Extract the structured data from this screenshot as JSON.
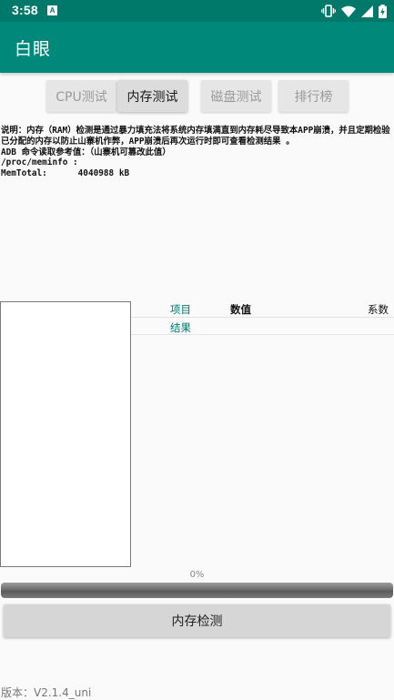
{
  "status_bar": {
    "time": "3:58",
    "notification_icon": "A",
    "icons": [
      "vibrate-icon",
      "wifi-icon",
      "signal-icon",
      "battery-charging-icon"
    ]
  },
  "app_bar": {
    "title": "白眼"
  },
  "tabs": [
    {
      "label": "CPU测试",
      "active": false
    },
    {
      "label": "内存测试",
      "active": true
    },
    {
      "label": "磁盘测试",
      "active": false
    },
    {
      "label": "排行榜",
      "active": false
    }
  ],
  "description": {
    "lines": [
      "说明：内存（RAM）检测是通过暴力填充法将系统内存填满直到内存耗尽导致本APP崩溃，并且定期检验已分配的内存以防止山寨机作弊，APP崩溃后再次运行时即可查看检测结果 。",
      "ADB 命令读取参考值：（山寨机可篡改此值）",
      "/proc/meminfo :",
      "MemTotal:      4040988 kB"
    ]
  },
  "table": {
    "header": {
      "item": "项目",
      "value": "数值",
      "coefficient": "系数"
    },
    "result_label": "结果"
  },
  "progress": {
    "text": "0%",
    "value": 0
  },
  "detect_button": {
    "label": "内存检测"
  },
  "version": "版本：V2.1.4_uni",
  "colors": {
    "status_bar": "#00796b",
    "app_bar": "#00897b",
    "accent_text": "#00796b"
  }
}
